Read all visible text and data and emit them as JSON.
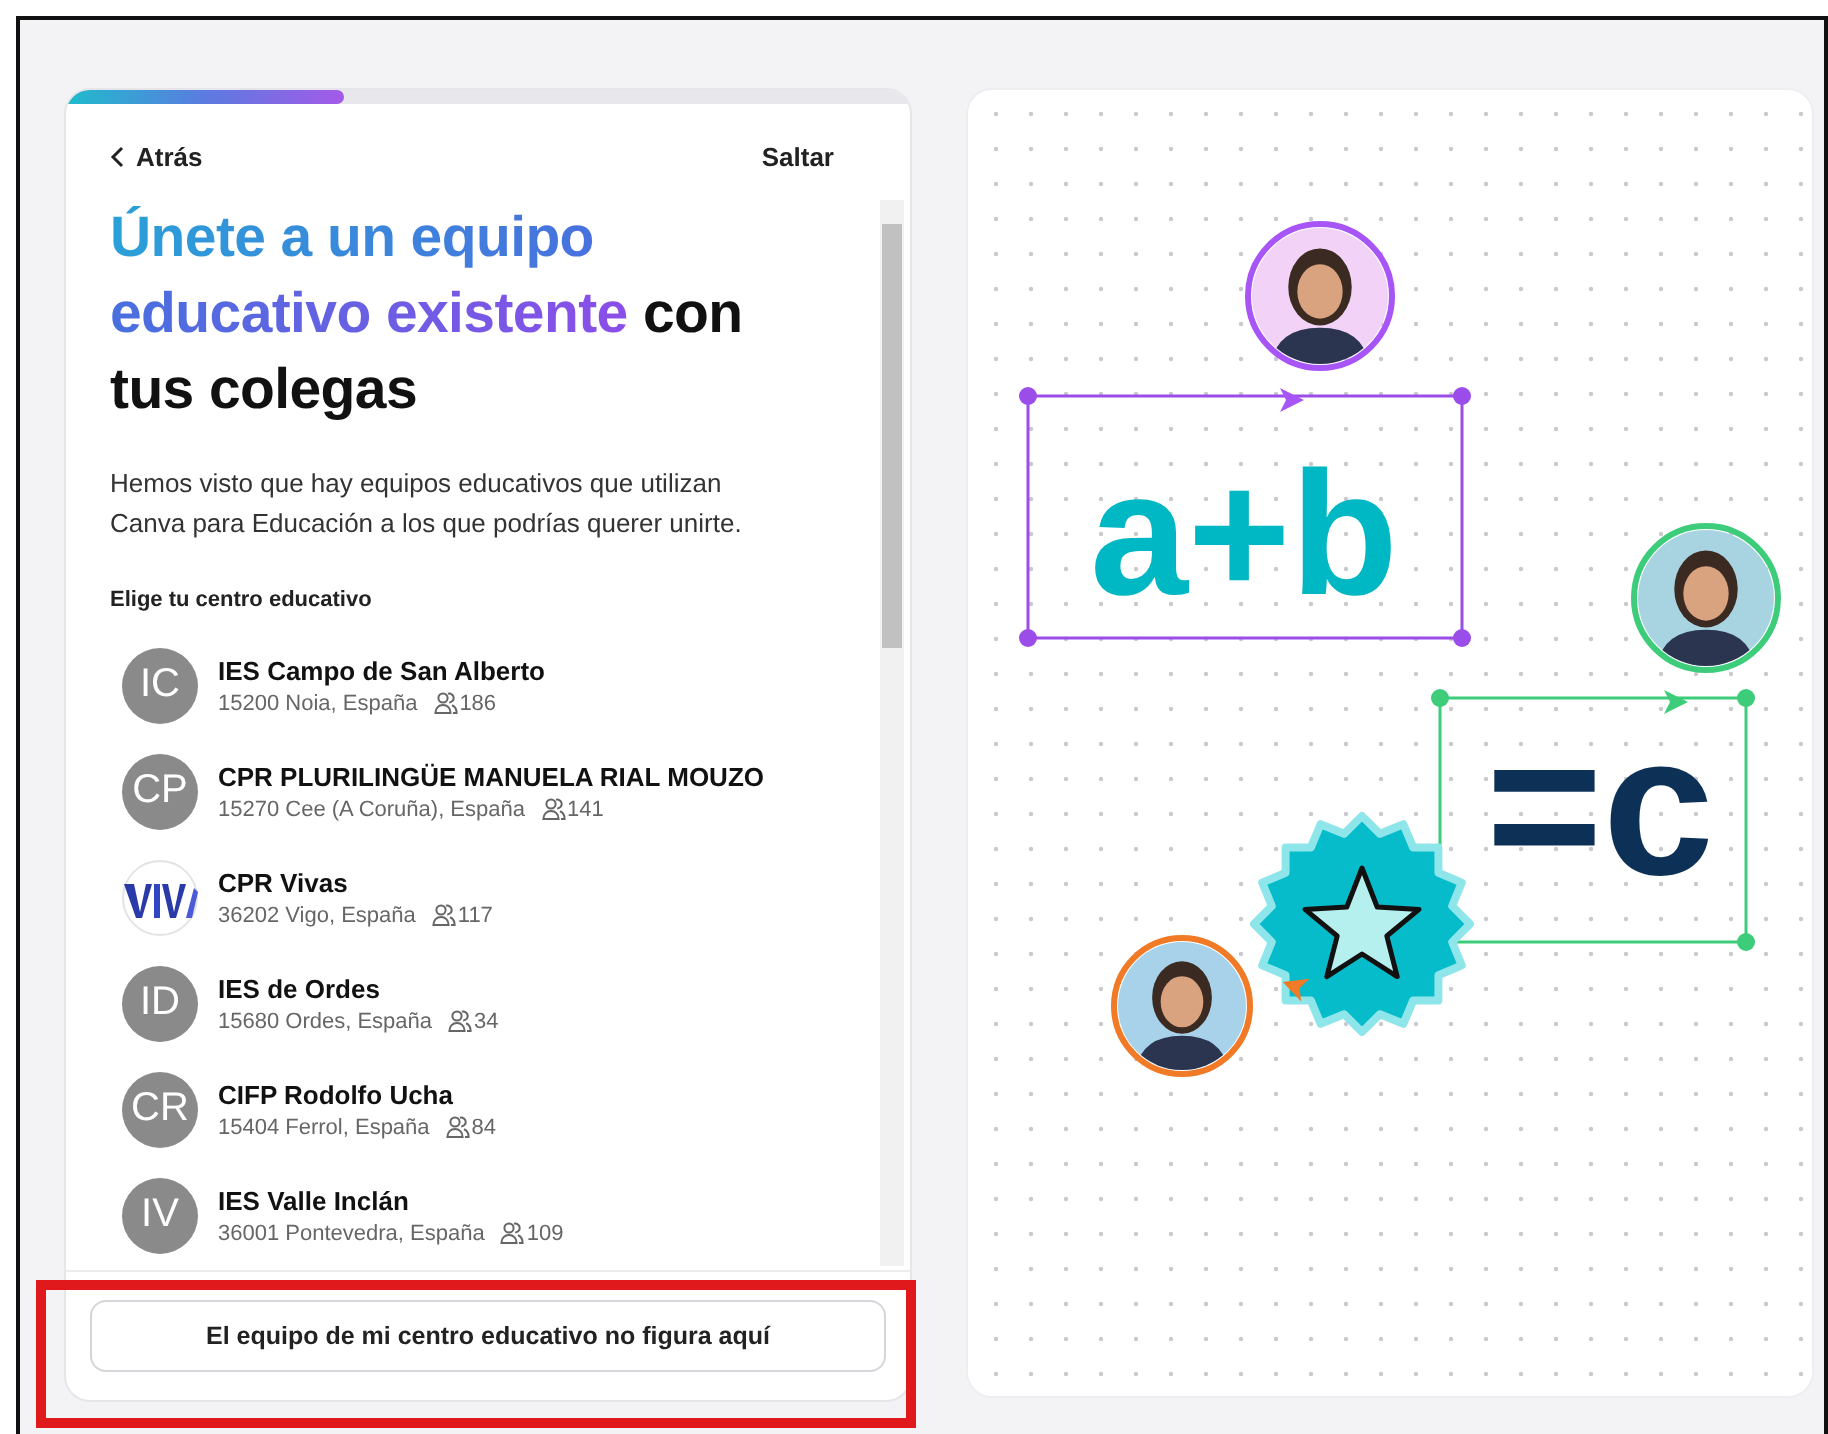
{
  "progress": {
    "level": 0.33
  },
  "header": {
    "back": "Atrás",
    "skip": "Saltar"
  },
  "title": {
    "highlight": "Únete a un equipo educativo existente",
    "rest": "con tus colegas"
  },
  "description": "Hemos visto que hay equipos educativos que utilizan Canva para Educación a los que podrías querer unirte.",
  "list_label": "Elige tu centro educativo",
  "schools": [
    {
      "kind": "initials",
      "initials": "IC",
      "name": "IES Campo de San Alberto",
      "location": "15200 Noia, España",
      "members": "186"
    },
    {
      "kind": "initials",
      "initials": "CP",
      "name": "CPR PLURILINGÜE MANUELA RIAL MOUZO",
      "location": "15270 Cee (A Coruña), España",
      "members": "141"
    },
    {
      "kind": "logo",
      "name": "CPR Vivas",
      "location": "36202 Vigo, España",
      "members": "117"
    },
    {
      "kind": "initials",
      "initials": "ID",
      "name": "IES de Ordes",
      "location": "15680 Ordes, España",
      "members": "34"
    },
    {
      "kind": "initials",
      "initials": "CR",
      "name": "CIFP Rodolfo Ucha",
      "location": "15404 Ferrol, España",
      "members": "84"
    },
    {
      "kind": "initials",
      "initials": "IV",
      "name": "IES Valle Inclán",
      "location": "36001 Pontevedra, España",
      "members": "109"
    }
  ],
  "footer": {
    "button": "El equipo de mi centro educativo no figura aquí",
    "highlighted": true
  },
  "canvas": {
    "expressions": [
      {
        "text": "a+b",
        "color": "#9b4dea"
      },
      {
        "text": "=c",
        "color": "#3dcc7a"
      }
    ],
    "collaborators": [
      {
        "color": "#a855f7"
      },
      {
        "color": "#3dcc7a"
      },
      {
        "color": "#f07a25"
      }
    ]
  }
}
